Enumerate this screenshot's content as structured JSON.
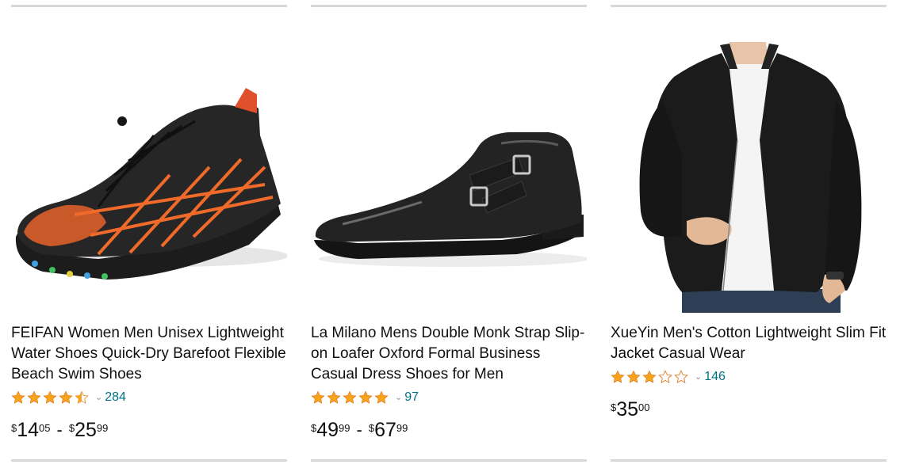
{
  "products": [
    {
      "title": "FEIFAN Women Men Unisex Lightweight Water Shoes Quick-Dry Barefoot Flexible Beach Swim Shoes",
      "rating": 4.5,
      "review_count": "284",
      "price_low": {
        "symbol": "$",
        "whole": "14",
        "fraction": "05"
      },
      "price_sep": "-",
      "price_high": {
        "symbol": "$",
        "whole": "25",
        "fraction": "99"
      }
    },
    {
      "title": "La Milano Mens Double Monk Strap Slip-on Loafer Oxford Formal Business Casual Dress Shoes for Men",
      "rating": 5,
      "review_count": "97",
      "price_low": {
        "symbol": "$",
        "whole": "49",
        "fraction": "99"
      },
      "price_sep": "-",
      "price_high": {
        "symbol": "$",
        "whole": "67",
        "fraction": "99"
      }
    },
    {
      "title": "XueYin Men's Cotton Lightweight Slim Fit Jacket Casual Wear",
      "rating": 3,
      "review_count": "146",
      "price": {
        "symbol": "$",
        "whole": "35",
        "fraction": "00"
      }
    }
  ],
  "colors": {
    "star": "#f8a41b",
    "star_outline": "#de7921",
    "link": "#007185",
    "divider": "#d5d9d9"
  }
}
